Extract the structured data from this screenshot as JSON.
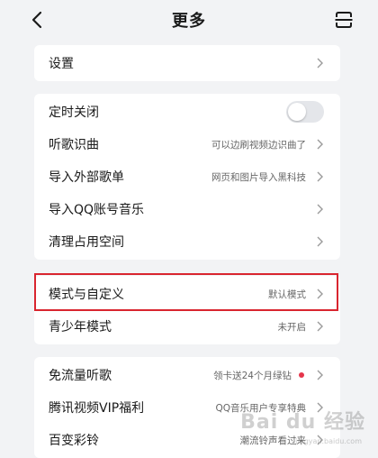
{
  "header": {
    "title": "更多",
    "back_icon": "chevron-left-icon",
    "scan_icon": "scan-icon"
  },
  "group1": {
    "items": [
      {
        "label": "设置",
        "value": ""
      }
    ]
  },
  "group2": {
    "items": [
      {
        "label": "定时关闭",
        "value": "",
        "toggle_on": false
      },
      {
        "label": "听歌识曲",
        "value": "可以边刷视频边识曲了"
      },
      {
        "label": "导入外部歌单",
        "value": "网页和图片导入黑科技"
      },
      {
        "label": "导入QQ账号音乐",
        "value": ""
      },
      {
        "label": "清理占用空间",
        "value": ""
      }
    ]
  },
  "group3": {
    "items": [
      {
        "label": "模式与自定义",
        "value": "默认模式"
      },
      {
        "label": "青少年模式",
        "value": "未开启"
      }
    ]
  },
  "group4": {
    "items": [
      {
        "label": "免流量听歌",
        "value": "领卡送24个月绿钻"
      },
      {
        "label": "腾讯视频VIP福利",
        "value": "QQ音乐用户专享特典"
      },
      {
        "label": "百变彩铃",
        "value": "潮流铃声看过来"
      }
    ]
  },
  "watermark": {
    "text": "Bai du 经验",
    "sub": "jingyan.baidu.com"
  },
  "colors": {
    "background": "#f2f3f5",
    "card": "#ffffff",
    "highlight": "#d9252f",
    "dot": "#e5364b"
  }
}
